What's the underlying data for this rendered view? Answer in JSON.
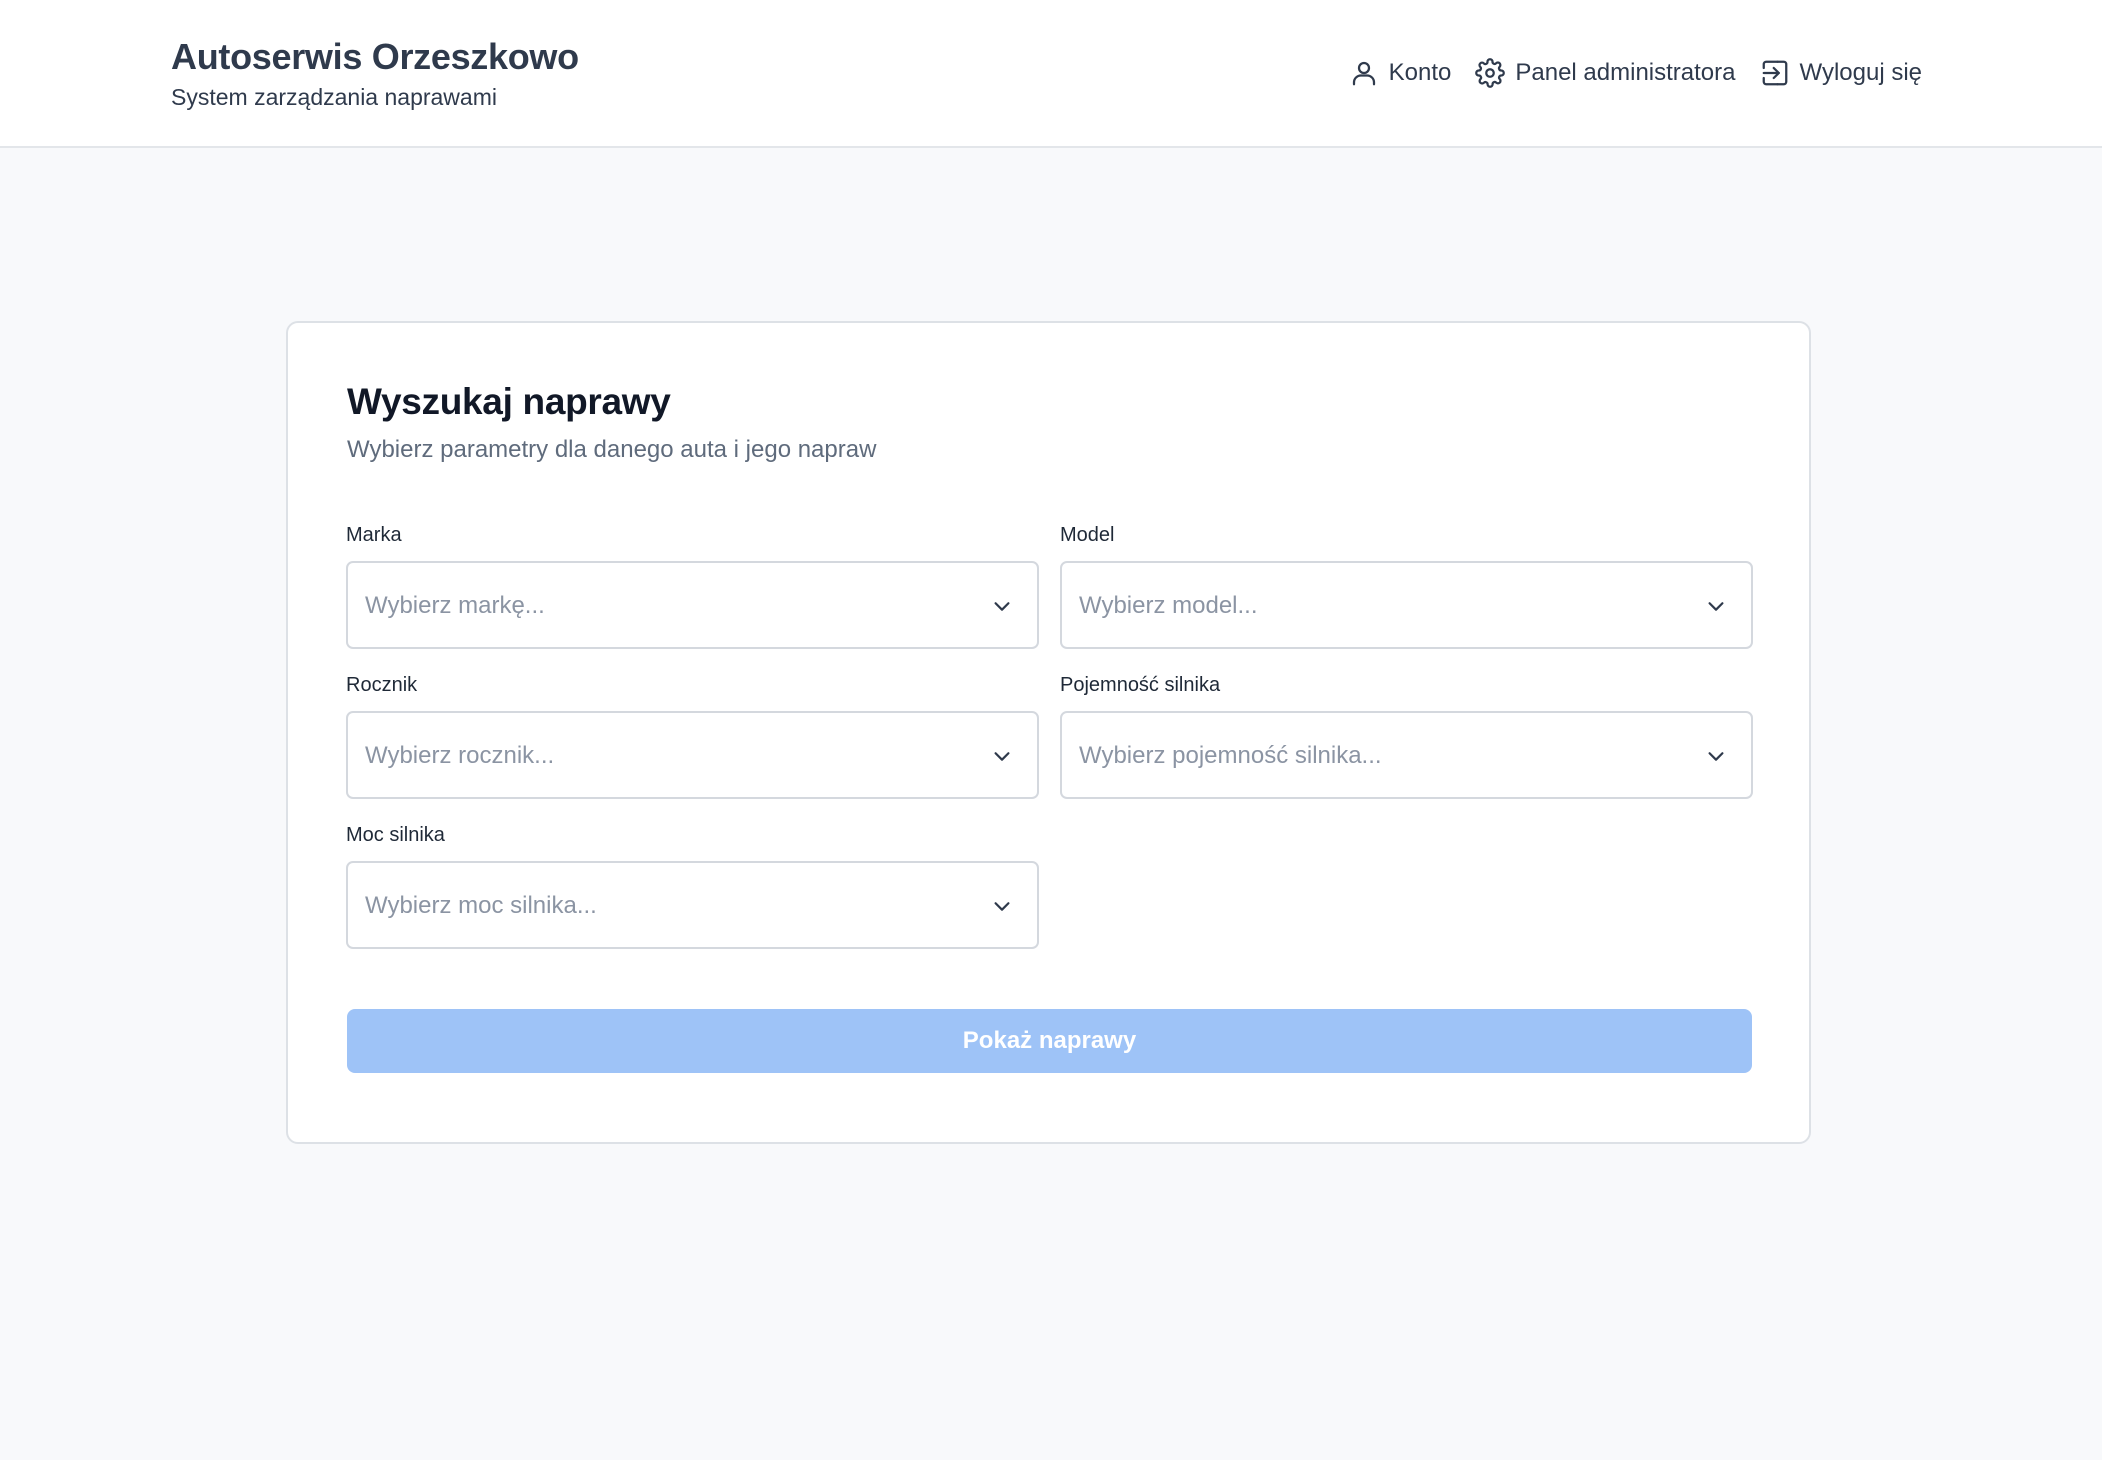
{
  "header": {
    "title": "Autoserwis Orzeszkowo",
    "subtitle": "System zarządzania naprawami",
    "nav": [
      {
        "label": "Konto",
        "icon": "user-icon"
      },
      {
        "label": "Panel administratora",
        "icon": "gear-icon"
      },
      {
        "label": "Wyloguj się",
        "icon": "logout-icon"
      }
    ]
  },
  "search_card": {
    "title": "Wyszukaj naprawy",
    "subtitle": "Wybierz parametry dla danego auta i jego napraw",
    "fields": [
      {
        "label": "Marka",
        "placeholder": "Wybierz markę..."
      },
      {
        "label": "Model",
        "placeholder": "Wybierz model..."
      },
      {
        "label": "Rocznik",
        "placeholder": "Wybierz rocznik..."
      },
      {
        "label": "Pojemność silnika",
        "placeholder": "Wybierz pojemność silnika..."
      },
      {
        "label": "Moc silnika",
        "placeholder": "Wybierz moc silnika..."
      }
    ],
    "submit_label": "Pokaż naprawy"
  },
  "colors": {
    "accent_disabled": "#9ec3f7",
    "text_dark": "#2f3a4c",
    "placeholder": "#8b94a3",
    "background": "#f8f9fb"
  }
}
